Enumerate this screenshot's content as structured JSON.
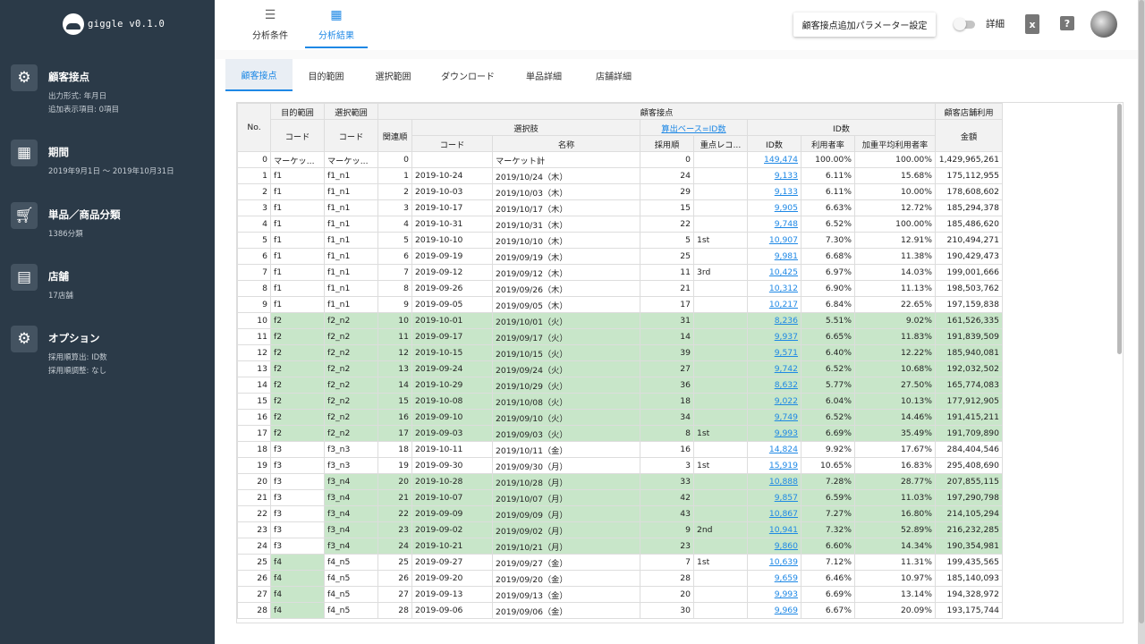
{
  "app": {
    "logo_text": "giggle v0.1.0"
  },
  "sidebar": {
    "items": [
      {
        "title": "顧客接点",
        "icon": "gear-icon",
        "sub": [
          "出力形式: 年月日",
          "追加表示項目: 0項目"
        ]
      },
      {
        "title": "期間",
        "icon": "calendar-icon",
        "sub": [
          "2019年9月1日 〜 2019年10月31日"
        ]
      },
      {
        "title": "単品／商品分類",
        "icon": "cart-icon",
        "sub": [
          "1386分類"
        ]
      },
      {
        "title": "店舗",
        "icon": "store-icon",
        "sub": [
          "17店舗"
        ]
      },
      {
        "title": "オプション",
        "icon": "gear-icon",
        "sub": [
          "採用順算出: ID数",
          "採用順調整: なし"
        ]
      }
    ]
  },
  "topbar": {
    "tabs": [
      {
        "label": "分析条件",
        "icon": "filter-icon"
      },
      {
        "label": "分析結果",
        "icon": "table-icon"
      }
    ],
    "param_button": "顧客接点追加パラメーター設定",
    "toggle_label": "詳細",
    "excel_icon_glyph": "x",
    "help_icon_glyph": "?"
  },
  "subtabs": [
    "顧客接点",
    "目的範囲",
    "選択範囲",
    "ダウンロード",
    "単品詳細",
    "店舗詳細"
  ],
  "table": {
    "headers": {
      "no": "No.",
      "mokuteki": "目的範囲",
      "sentaku_hanni": "選択範囲",
      "kokyaku_setten": "顧客接点",
      "kokyaku_tenpo": "顧客店舗利用",
      "code1": "コード",
      "code2": "コード",
      "kanren": "関連順",
      "sentakushi": "選択肢",
      "santei_base": "算出ベース=ID数",
      "id_group": "ID数",
      "kingaku": "金額",
      "code3": "コード",
      "meisho": "名称",
      "saiyo": "採用順",
      "juten": "重点レコ...",
      "idsu": "ID数",
      "riyo": "利用者率",
      "kaju": "加重平均利用者率"
    },
    "rows": [
      {
        "no": "0",
        "c1": "マーケッ...",
        "c2": "マーケッ...",
        "rel": "0",
        "code": "",
        "name": "マーケット計",
        "adopt": "0",
        "focus": "",
        "ids": "149,474",
        "rate": "100.00%",
        "wavg": "100.00%",
        "amount": "1,429,965,261"
      },
      {
        "no": "1",
        "c1": "f1",
        "c2": "f1_n1",
        "rel": "1",
        "code": "2019-10-24",
        "name": "2019/10/24（木）",
        "adopt": "24",
        "focus": "",
        "ids": "9,133",
        "rate": "6.11%",
        "wavg": "15.68%",
        "amount": "175,112,955"
      },
      {
        "no": "2",
        "c1": "f1",
        "c2": "f1_n1",
        "rel": "2",
        "code": "2019-10-03",
        "name": "2019/10/03（木）",
        "adopt": "29",
        "focus": "",
        "ids": "9,133",
        "rate": "6.11%",
        "wavg": "10.00%",
        "amount": "178,608,602"
      },
      {
        "no": "3",
        "c1": "f1",
        "c2": "f1_n1",
        "rel": "3",
        "code": "2019-10-17",
        "name": "2019/10/17（木）",
        "adopt": "15",
        "focus": "",
        "ids": "9,905",
        "rate": "6.63%",
        "wavg": "12.72%",
        "amount": "185,294,378"
      },
      {
        "no": "4",
        "c1": "f1",
        "c2": "f1_n1",
        "rel": "4",
        "code": "2019-10-31",
        "name": "2019/10/31（木）",
        "adopt": "22",
        "focus": "",
        "ids": "9,748",
        "rate": "6.52%",
        "wavg": "100.00%",
        "amount": "185,486,620"
      },
      {
        "no": "5",
        "c1": "f1",
        "c2": "f1_n1",
        "rel": "5",
        "code": "2019-10-10",
        "name": "2019/10/10（木）",
        "adopt": "5",
        "focus": "1st",
        "ids": "10,907",
        "rate": "7.30%",
        "wavg": "12.91%",
        "amount": "210,494,271"
      },
      {
        "no": "6",
        "c1": "f1",
        "c2": "f1_n1",
        "rel": "6",
        "code": "2019-09-19",
        "name": "2019/09/19（木）",
        "adopt": "25",
        "focus": "",
        "ids": "9,981",
        "rate": "6.68%",
        "wavg": "11.38%",
        "amount": "190,429,473"
      },
      {
        "no": "7",
        "c1": "f1",
        "c2": "f1_n1",
        "rel": "7",
        "code": "2019-09-12",
        "name": "2019/09/12（木）",
        "adopt": "11",
        "focus": "3rd",
        "ids": "10,425",
        "rate": "6.97%",
        "wavg": "14.03%",
        "amount": "199,001,666"
      },
      {
        "no": "8",
        "c1": "f1",
        "c2": "f1_n1",
        "rel": "8",
        "code": "2019-09-26",
        "name": "2019/09/26（木）",
        "adopt": "21",
        "focus": "",
        "ids": "10,312",
        "rate": "6.90%",
        "wavg": "11.13%",
        "amount": "198,503,762"
      },
      {
        "no": "9",
        "c1": "f1",
        "c2": "f1_n1",
        "rel": "9",
        "code": "2019-09-05",
        "name": "2019/09/05（木）",
        "adopt": "17",
        "focus": "",
        "ids": "10,217",
        "rate": "6.84%",
        "wavg": "22.65%",
        "amount": "197,159,838"
      },
      {
        "no": "10",
        "c1": "f2",
        "c2": "f2_n2",
        "rel": "10",
        "code": "2019-10-01",
        "name": "2019/10/01（火）",
        "adopt": "31",
        "focus": "",
        "ids": "8,236",
        "rate": "5.51%",
        "wavg": "9.02%",
        "amount": "161,526,335"
      },
      {
        "no": "11",
        "c1": "f2",
        "c2": "f2_n2",
        "rel": "11",
        "code": "2019-09-17",
        "name": "2019/09/17（火）",
        "adopt": "14",
        "focus": "",
        "ids": "9,937",
        "rate": "6.65%",
        "wavg": "11.83%",
        "amount": "191,839,509"
      },
      {
        "no": "12",
        "c1": "f2",
        "c2": "f2_n2",
        "rel": "12",
        "code": "2019-10-15",
        "name": "2019/10/15（火）",
        "adopt": "39",
        "focus": "",
        "ids": "9,571",
        "rate": "6.40%",
        "wavg": "12.22%",
        "amount": "185,940,081"
      },
      {
        "no": "13",
        "c1": "f2",
        "c2": "f2_n2",
        "rel": "13",
        "code": "2019-09-24",
        "name": "2019/09/24（火）",
        "adopt": "27",
        "focus": "",
        "ids": "9,742",
        "rate": "6.52%",
        "wavg": "10.68%",
        "amount": "192,032,502"
      },
      {
        "no": "14",
        "c1": "f2",
        "c2": "f2_n2",
        "rel": "14",
        "code": "2019-10-29",
        "name": "2019/10/29（火）",
        "adopt": "36",
        "focus": "",
        "ids": "8,632",
        "rate": "5.77%",
        "wavg": "27.50%",
        "amount": "165,774,083"
      },
      {
        "no": "15",
        "c1": "f2",
        "c2": "f2_n2",
        "rel": "15",
        "code": "2019-10-08",
        "name": "2019/10/08（火）",
        "adopt": "18",
        "focus": "",
        "ids": "9,022",
        "rate": "6.04%",
        "wavg": "10.13%",
        "amount": "177,912,905"
      },
      {
        "no": "16",
        "c1": "f2",
        "c2": "f2_n2",
        "rel": "16",
        "code": "2019-09-10",
        "name": "2019/09/10（火）",
        "adopt": "34",
        "focus": "",
        "ids": "9,749",
        "rate": "6.52%",
        "wavg": "14.46%",
        "amount": "191,415,211"
      },
      {
        "no": "17",
        "c1": "f2",
        "c2": "f2_n2",
        "rel": "17",
        "code": "2019-09-03",
        "name": "2019/09/03（火）",
        "adopt": "8",
        "focus": "1st",
        "ids": "9,993",
        "rate": "6.69%",
        "wavg": "35.49%",
        "amount": "191,709,890"
      },
      {
        "no": "18",
        "c1": "f3",
        "c2": "f3_n3",
        "rel": "18",
        "code": "2019-10-11",
        "name": "2019/10/11（金）",
        "adopt": "16",
        "focus": "",
        "ids": "14,824",
        "rate": "9.92%",
        "wavg": "17.67%",
        "amount": "284,404,546"
      },
      {
        "no": "19",
        "c1": "f3",
        "c2": "f3_n3",
        "rel": "19",
        "code": "2019-09-30",
        "name": "2019/09/30（月）",
        "adopt": "3",
        "focus": "1st",
        "ids": "15,919",
        "rate": "10.65%",
        "wavg": "16.83%",
        "amount": "295,408,690"
      },
      {
        "no": "20",
        "c1": "f3",
        "c2": "f3_n4",
        "rel": "20",
        "code": "2019-10-28",
        "name": "2019/10/28（月）",
        "adopt": "33",
        "focus": "",
        "ids": "10,888",
        "rate": "7.28%",
        "wavg": "28.77%",
        "amount": "207,855,115"
      },
      {
        "no": "21",
        "c1": "f3",
        "c2": "f3_n4",
        "rel": "21",
        "code": "2019-10-07",
        "name": "2019/10/07（月）",
        "adopt": "42",
        "focus": "",
        "ids": "9,857",
        "rate": "6.59%",
        "wavg": "11.03%",
        "amount": "197,290,798"
      },
      {
        "no": "22",
        "c1": "f3",
        "c2": "f3_n4",
        "rel": "22",
        "code": "2019-09-09",
        "name": "2019/09/09（月）",
        "adopt": "43",
        "focus": "",
        "ids": "10,867",
        "rate": "7.27%",
        "wavg": "16.80%",
        "amount": "214,105,294"
      },
      {
        "no": "23",
        "c1": "f3",
        "c2": "f3_n4",
        "rel": "23",
        "code": "2019-09-02",
        "name": "2019/09/02（月）",
        "adopt": "9",
        "focus": "2nd",
        "ids": "10,941",
        "rate": "7.32%",
        "wavg": "52.89%",
        "amount": "216,232,285"
      },
      {
        "no": "24",
        "c1": "f3",
        "c2": "f3_n4",
        "rel": "24",
        "code": "2019-10-21",
        "name": "2019/10/21（月）",
        "adopt": "23",
        "focus": "",
        "ids": "9,860",
        "rate": "6.60%",
        "wavg": "14.34%",
        "amount": "190,354,981"
      },
      {
        "no": "25",
        "c1": "f4",
        "c2": "f4_n5",
        "rel": "25",
        "code": "2019-09-27",
        "name": "2019/09/27（金）",
        "adopt": "7",
        "focus": "1st",
        "ids": "10,639",
        "rate": "7.12%",
        "wavg": "11.31%",
        "amount": "199,435,565"
      },
      {
        "no": "26",
        "c1": "f4",
        "c2": "f4_n5",
        "rel": "26",
        "code": "2019-09-20",
        "name": "2019/09/20（金）",
        "adopt": "28",
        "focus": "",
        "ids": "9,659",
        "rate": "6.46%",
        "wavg": "10.97%",
        "amount": "185,140,093"
      },
      {
        "no": "27",
        "c1": "f4",
        "c2": "f4_n5",
        "rel": "27",
        "code": "2019-09-13",
        "name": "2019/09/13（金）",
        "adopt": "20",
        "focus": "",
        "ids": "9,993",
        "rate": "6.69%",
        "wavg": "13.14%",
        "amount": "194,328,972"
      },
      {
        "no": "28",
        "c1": "f4",
        "c2": "f4_n5",
        "rel": "28",
        "code": "2019-09-06",
        "name": "2019/09/06（金）",
        "adopt": "30",
        "focus": "",
        "ids": "9,969",
        "rate": "6.67%",
        "wavg": "20.09%",
        "amount": "193,175,744"
      }
    ]
  },
  "colors": {
    "sidebar_bg": "#2b3a48",
    "accent": "#1e88e5",
    "highlight_green": "#c8e6c9"
  }
}
